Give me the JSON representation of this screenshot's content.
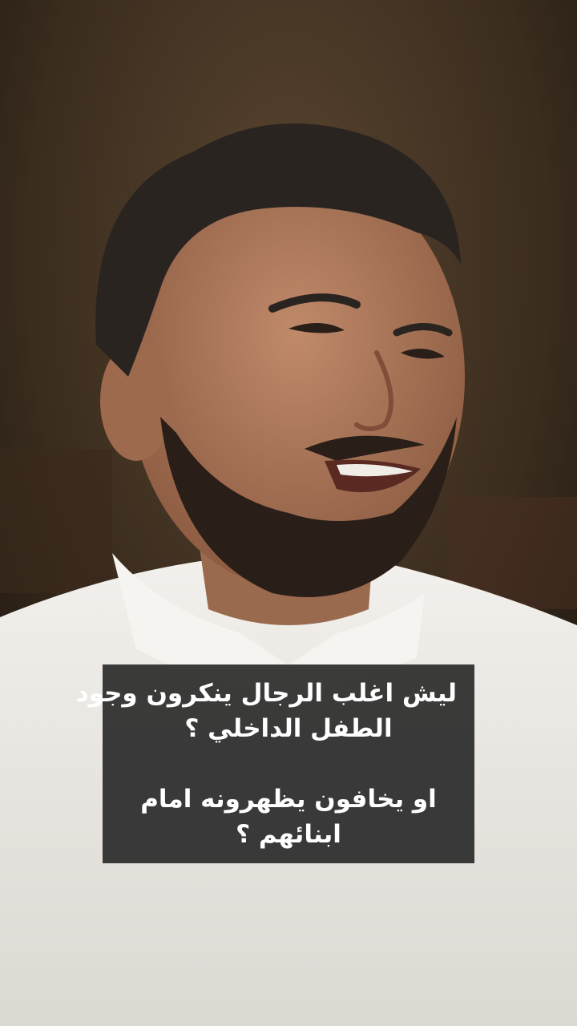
{
  "caption": {
    "lines": [
      "ليش اغلب الرجال ينكرون وجود",
      "الطفل الداخلي ؟",
      "او يخافون يظهرونه امام",
      "ابنائهم  ؟"
    ]
  },
  "scene": {
    "subject": "man-with-beard",
    "colors": {
      "background_dark": "#1a140e",
      "background_warm": "#5a4530",
      "shirt": "#eceae6",
      "skin": "#b07a5c",
      "hair": "#2a2420",
      "caption_bg": "#2a2a2a",
      "caption_text": "#ffffff"
    }
  }
}
